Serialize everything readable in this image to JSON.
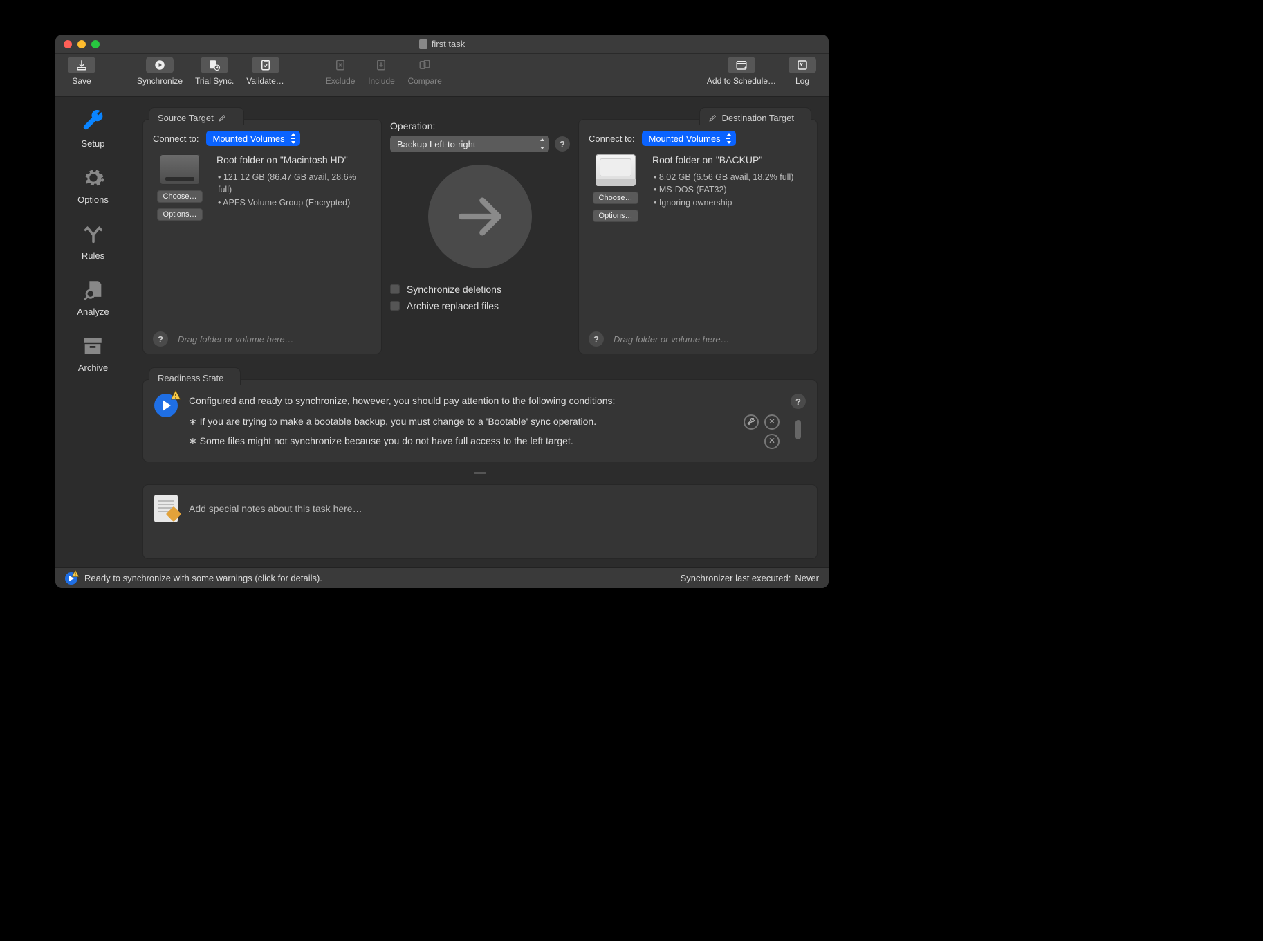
{
  "window": {
    "title": "first task"
  },
  "toolbar": {
    "save": "Save",
    "synchronize": "Synchronize",
    "trial_sync": "Trial Sync.",
    "validate": "Validate…",
    "exclude": "Exclude",
    "include": "Include",
    "compare": "Compare",
    "add_schedule": "Add to Schedule…",
    "log": "Log"
  },
  "sidebar": {
    "setup": "Setup",
    "options": "Options",
    "rules": "Rules",
    "analyze": "Analyze",
    "archive": "Archive"
  },
  "source": {
    "tab": "Source Target",
    "connect_label": "Connect to:",
    "connect_value": "Mounted Volumes",
    "title": "Root folder on \"Macintosh HD\"",
    "bullets": [
      "121.12 GB (86.47 GB avail, 28.6% full)",
      "APFS Volume Group (Encrypted)"
    ],
    "choose": "Choose…",
    "options": "Options…",
    "hint": "Drag folder or volume here…"
  },
  "destination": {
    "tab": "Destination Target",
    "connect_label": "Connect to:",
    "connect_value": "Mounted Volumes",
    "title": "Root folder on \"BACKUP\"",
    "bullets": [
      "8.02 GB (6.56 GB avail, 18.2% full)",
      "MS-DOS (FAT32)",
      "Ignoring ownership"
    ],
    "choose": "Choose…",
    "options": "Options…",
    "hint": "Drag folder or volume here…"
  },
  "operation": {
    "label": "Operation:",
    "value": "Backup Left-to-right",
    "sync_deletions": "Synchronize deletions",
    "archive_replaced": "Archive replaced files"
  },
  "readiness": {
    "tab": "Readiness State",
    "headline": "Configured and ready to synchronize, however, you should pay attention to the following conditions:",
    "items": [
      "If you are trying to make a bootable backup, you must change to a 'Bootable' sync operation.",
      "Some files might not synchronize because you do not have full access to the left target."
    ]
  },
  "notes": {
    "placeholder": "Add special notes about this task here…"
  },
  "status": {
    "left": "Ready to synchronize with some warnings (click for details).",
    "right_label": "Synchronizer last executed:",
    "right_value": "Never"
  }
}
